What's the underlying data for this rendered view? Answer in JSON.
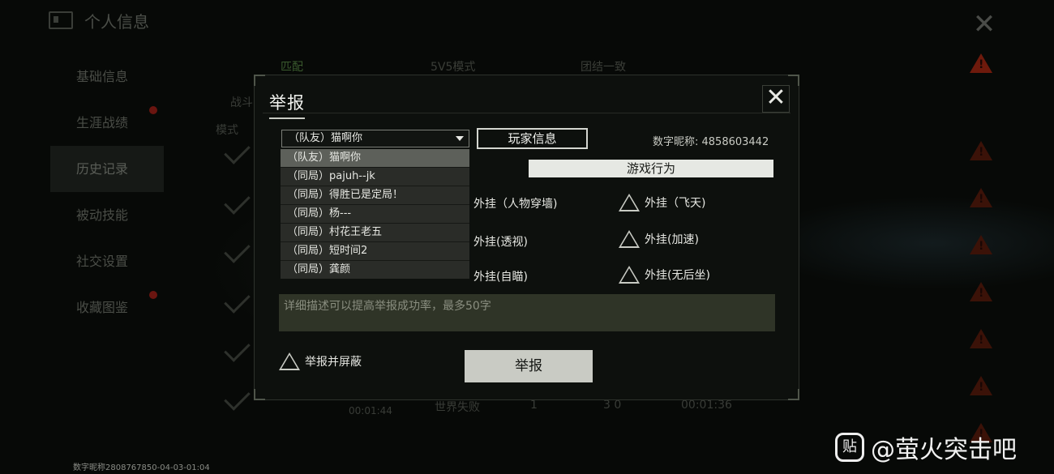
{
  "page": {
    "title": "个人信息",
    "footer_id": "数字昵称2808767850-04-03-01:04"
  },
  "sidebar": {
    "items": [
      {
        "label": "基础信息"
      },
      {
        "label": "生涯战绩"
      },
      {
        "label": "历史记录"
      },
      {
        "label": "被动技能"
      },
      {
        "label": "社交设置"
      },
      {
        "label": "收藏图鉴"
      }
    ]
  },
  "bg_tabs": [
    "匹配",
    "5V5模式",
    "团结一致"
  ],
  "bg_texts": {
    "mode_label": "战斗",
    "col_label": "模式",
    "row_result": "世界失败",
    "row_count": "1",
    "row_kills": "3 0",
    "row_time": "00:01:36",
    "row_time2": "00:01:44"
  },
  "dialog": {
    "title": "举报",
    "close_symbol": "✕",
    "selected_player": "（队友）猫啊你",
    "player_info_label": "玩家信息",
    "nickname": "数字昵称: 4858603442",
    "tab_label": "游戏行为",
    "options": [
      {
        "label": "外挂（人物穿墙)"
      },
      {
        "label": "外挂（飞天)"
      },
      {
        "label": "外挂(透视)"
      },
      {
        "label": "外挂(加速)"
      },
      {
        "label": "外挂(自瞄)"
      },
      {
        "label": "外挂(无后坐)"
      }
    ],
    "textarea_placeholder": "详细描述可以提高举报成功率，最多50字",
    "block_label": "举报并屏蔽",
    "report_label": "举报"
  },
  "dropdown": {
    "items": [
      {
        "label": "（队友）猫啊你"
      },
      {
        "label": "（同局）pajuh--jk"
      },
      {
        "label": "（同局）得胜已是定局！"
      },
      {
        "label": "（同局）杨---"
      },
      {
        "label": "（同局）村花王老五"
      },
      {
        "label": "（同局）短时间2"
      },
      {
        "label": "（同局）龚颜"
      }
    ]
  },
  "watermark": {
    "icon_text": "贴",
    "text": "@萤火突击吧"
  },
  "colors": {
    "accent_green": "#3a5a2e",
    "warning_red": "#6e1a0c",
    "panel_bg": "#0d100d"
  }
}
